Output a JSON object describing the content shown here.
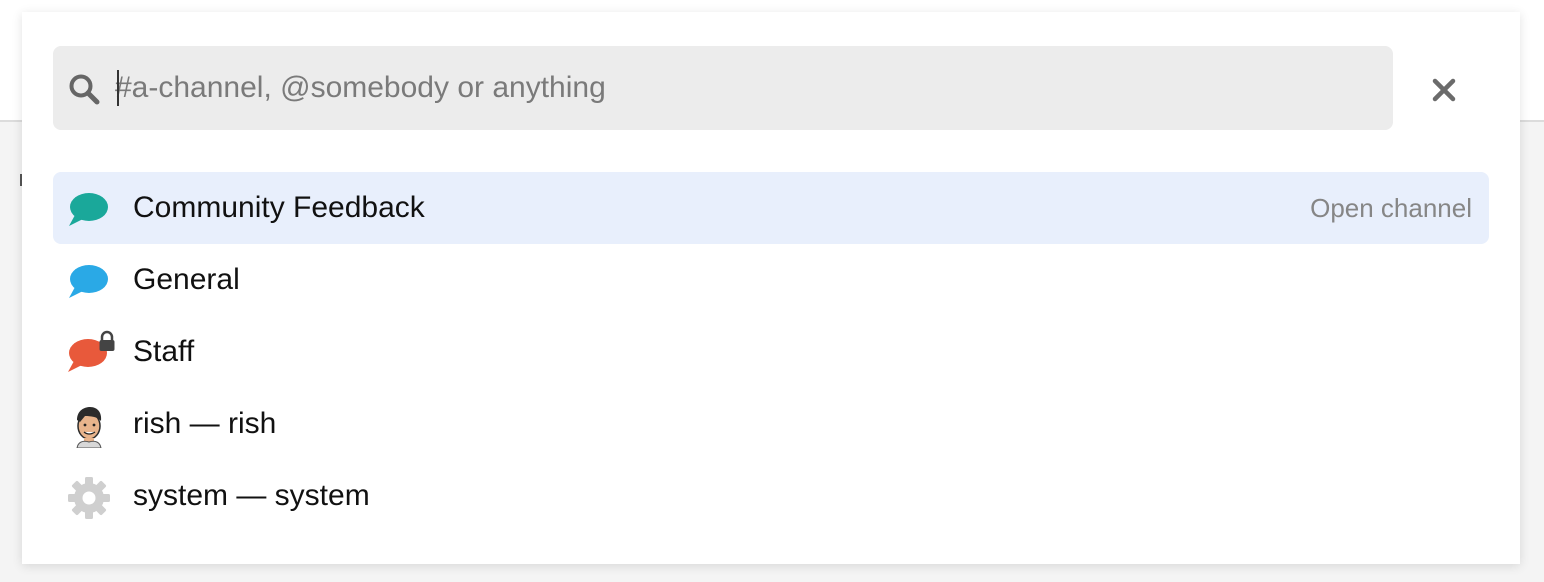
{
  "search": {
    "placeholder": "#a-channel, @somebody or anything",
    "value": ""
  },
  "results": [
    {
      "type": "channel",
      "label": "Community Feedback",
      "hint": "Open channel",
      "color": "#1aa89a",
      "private": false,
      "selected": true
    },
    {
      "type": "channel",
      "label": "General",
      "hint": "",
      "color": "#2aa9e6",
      "private": false,
      "selected": false
    },
    {
      "type": "channel",
      "label": "Staff",
      "hint": "",
      "color": "#e8593b",
      "private": true,
      "selected": false
    },
    {
      "type": "user",
      "label": "rish — rish",
      "hint": "",
      "icon": "avatar-icon",
      "selected": false
    },
    {
      "type": "user",
      "label": "system — system",
      "hint": "",
      "icon": "gear-icon",
      "selected": false
    }
  ],
  "colors": {
    "selected_row": "#e8effc",
    "search_bg": "#ececec"
  }
}
